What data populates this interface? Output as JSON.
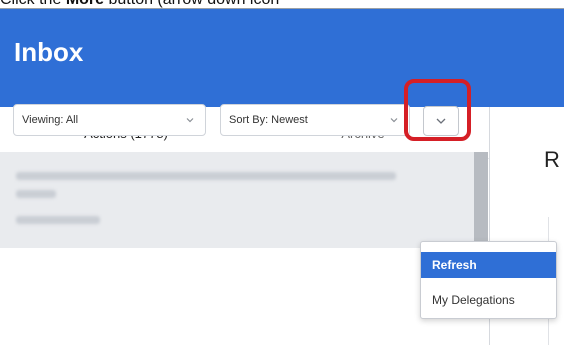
{
  "instruction": {
    "prefix": "Click the",
    "bold": "More",
    "suffix": "button (arrow down icon"
  },
  "header": {
    "title": "Inbox"
  },
  "tabs": [
    {
      "label": "Actions (1778)",
      "active": true
    },
    {
      "label": "Archive",
      "active": false
    }
  ],
  "filters": {
    "viewing": "Viewing: All",
    "sort": "Sort By: Newest"
  },
  "more_button": {
    "icon": "chevron-down-icon"
  },
  "dropdown": {
    "items": [
      {
        "label": "Refresh",
        "selected": true
      },
      {
        "label": "My Delegations",
        "selected": false
      }
    ]
  },
  "right_pane": {
    "title_partial": "R"
  },
  "colors": {
    "brand": "#2f6fd6",
    "highlight": "#d51f26",
    "list_background": "#e9ebee"
  }
}
